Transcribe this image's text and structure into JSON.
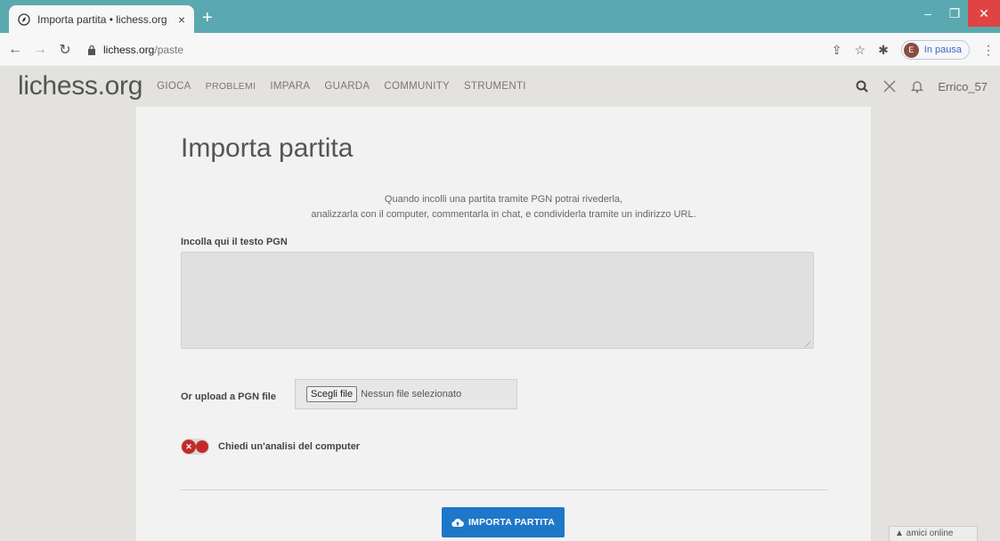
{
  "browser": {
    "tab_title": "Importa partita • lichess.org",
    "tab_close": "×",
    "new_tab": "+",
    "url_host": "lichess.org",
    "url_path": "/paste",
    "profile_initial": "E",
    "profile_status": "In pausa"
  },
  "header": {
    "logo": "lichess.org",
    "nav": [
      "GIOCA",
      "PROBLEMI",
      "IMPARA",
      "GUARDA",
      "COMMUNITY",
      "STRUMENTI"
    ],
    "username": "Errico_57"
  },
  "main": {
    "title": "Importa partita",
    "intro_line1": "Quando incolli una partita tramite PGN potrai rivederla,",
    "intro_line2": "analizzarla con il computer, commentarla in chat, e condividerla tramite un indirizzo URL.",
    "pgn_label": "Incolla qui il testo PGN",
    "pgn_value": "",
    "upload_label": "Or upload a PGN file",
    "file_button": "Scegli file",
    "file_status": "Nessun file selezionato",
    "analysis_label": "Chiedi un'analisi del computer",
    "analysis_enabled": false,
    "submit_label": "IMPORTA PARTITA"
  },
  "footer": {
    "friends": "▲ amici online"
  },
  "colors": {
    "tabbar": "#5aa9b0",
    "accent": "#1f77c9",
    "toggle_off": "#c32b2b"
  },
  "icons": [
    "lichess-favicon-icon",
    "back-arrow-icon",
    "forward-arrow-icon",
    "reload-icon",
    "lock-icon",
    "share-icon",
    "star-icon",
    "extensions-icon",
    "menu-dots-icon",
    "search-icon",
    "swords-icon",
    "bell-icon",
    "cloud-upload-icon"
  ]
}
